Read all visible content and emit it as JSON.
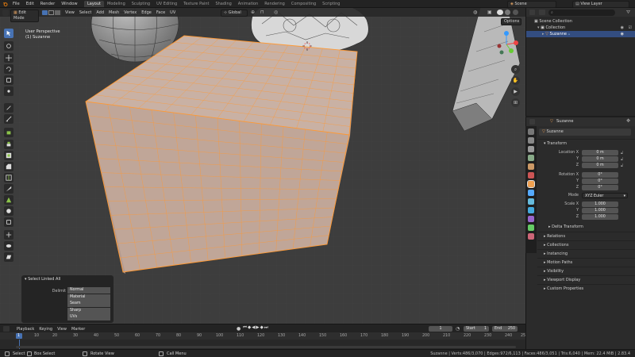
{
  "menu": {
    "items": [
      "File",
      "Edit",
      "Render",
      "Window",
      "Help"
    ],
    "workspaces": [
      "Layout",
      "Modeling",
      "Sculpting",
      "UV Editing",
      "Texture Paint",
      "Shading",
      "Animation",
      "Rendering",
      "Compositing",
      "Scripting"
    ],
    "active_workspace": "Layout",
    "scene": "Scene",
    "view_layer": "View Layer"
  },
  "viewport_header": {
    "mode": "Edit Mode",
    "menus": [
      "View",
      "Select",
      "Add",
      "Mesh",
      "Vertex",
      "Edge",
      "Face",
      "UV"
    ],
    "orientation": "Global",
    "options": "Options"
  },
  "viewport": {
    "perspective": "User Perspective",
    "object": "(1) Suzanne"
  },
  "redo_panel": {
    "title": "Select Linked All",
    "delimit_label": "Delimit",
    "options": [
      "Normal",
      "Material",
      "Seam",
      "Sharp",
      "UVs"
    ]
  },
  "outliner": {
    "root": "Scene Collection",
    "collection": "Collection",
    "object": "Suzanne"
  },
  "properties": {
    "object_name": "Suzanne",
    "transform_title": "Transform",
    "location": {
      "label": "Location X",
      "x": "0 m",
      "y": "0 m",
      "z": "0 m"
    },
    "rotation": {
      "label": "Rotation X",
      "x": "0°",
      "y": "0°",
      "z": "0°"
    },
    "mode_label": "Mode",
    "mode_value": "XYZ Euler",
    "scale": {
      "label": "Scale X",
      "x": "1.000",
      "y": "1.000",
      "z": "1.000"
    },
    "axis_y": "Y",
    "axis_z": "Z",
    "delta": "Delta Transform",
    "panels": [
      "Relations",
      "Collections",
      "Instancing",
      "Motion Paths",
      "Visibility",
      "Viewport Display",
      "Custom Properties"
    ]
  },
  "timeline": {
    "menus": [
      "Playback",
      "Keying",
      "View",
      "Marker"
    ],
    "current_frame": "1",
    "start_label": "Start",
    "start": "1",
    "end_label": "End",
    "end": "250",
    "ticks": [
      "1",
      "10",
      "20",
      "30",
      "40",
      "50",
      "60",
      "70",
      "80",
      "90",
      "100",
      "110",
      "120",
      "130",
      "140",
      "150",
      "160",
      "170",
      "180",
      "190",
      "200",
      "210",
      "220",
      "230",
      "240",
      "250"
    ]
  },
  "status": {
    "select": "Select",
    "box_select": "Box Select",
    "rotate_view": "Rotate View",
    "call_menu": "Call Menu",
    "stats": "Suzanne | Verts:486/3,070 | Edges:972/6,113 | Faces:486/3,051 | Tris:6,040 | Mem: 22.4 MiB | 2.83.4"
  },
  "colors": {
    "accent": "#4772b3",
    "edge_select": "#ff9933",
    "mesh_face": "#bfa79a"
  }
}
